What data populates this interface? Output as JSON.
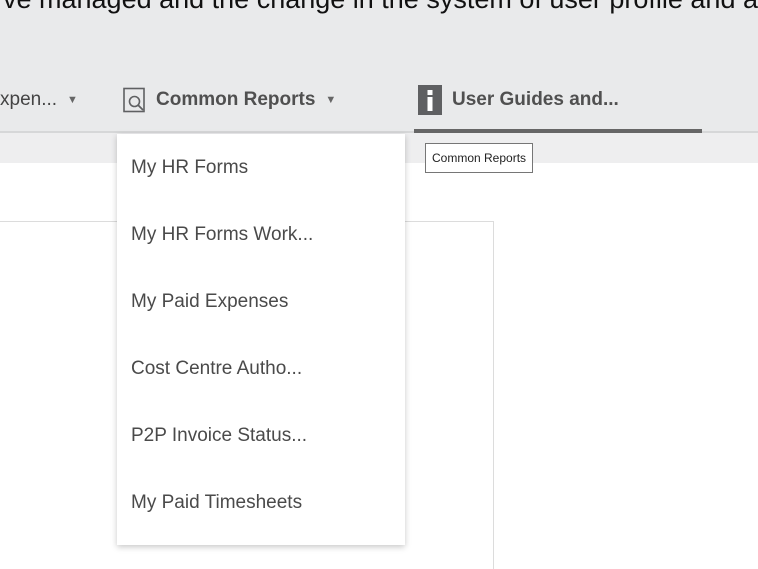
{
  "banner": {
    "text": "ve managed and the change in the system of user profile and a"
  },
  "nav": {
    "items": [
      {
        "label": "xpen...",
        "has_caret": true
      },
      {
        "label": "Common Reports",
        "has_caret": true,
        "icon": "document-search-icon"
      },
      {
        "label": "User Guides and...",
        "icon": "info-icon",
        "active": true
      }
    ],
    "caret_glyph": "▼"
  },
  "tooltip": {
    "text": "Common Reports"
  },
  "dropdown": {
    "items": [
      "My HR Forms",
      "My HR Forms Work...",
      "My Paid Expenses",
      "Cost Centre Autho...",
      "P2P Invoice Status...",
      "My Paid Timesheets"
    ]
  },
  "colors": {
    "navbar_bg": "#e9eaeb",
    "active_underline": "#666666",
    "info_icon_bg": "#5f6062"
  }
}
